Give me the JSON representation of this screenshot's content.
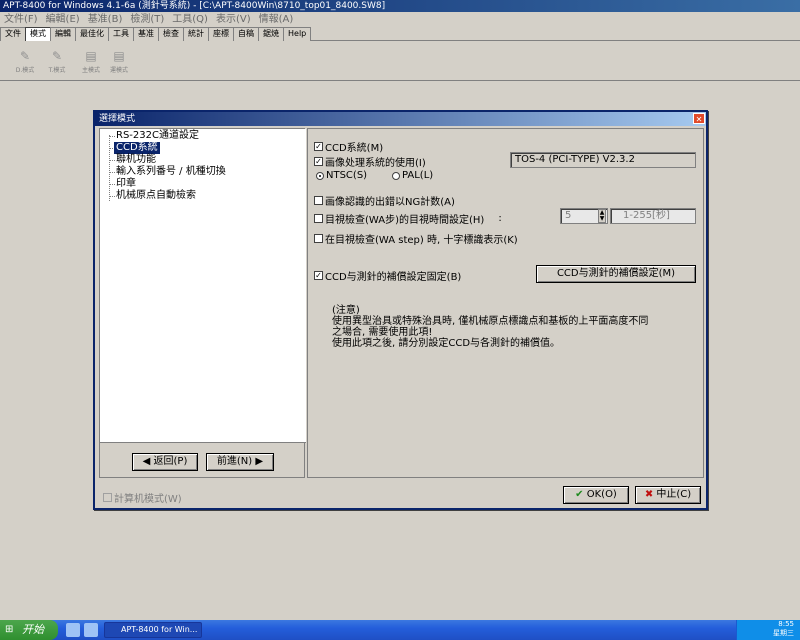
{
  "window": {
    "title": "APT-8400 for Windows 4.1-6a (測針号系統) - [C:\\APT-8400Win\\8710_top01_8400.SW8]"
  },
  "menu": [
    "文件(F)",
    "編輯(E)",
    "基准(B)",
    "檢測(T)",
    "工具(Q)",
    "表示(V)",
    "情報(A)"
  ],
  "tabs": [
    "文件",
    "模式",
    "編輯",
    "最佳化",
    "工具",
    "基准",
    "檢查",
    "統計",
    "座標",
    "自稿",
    "鋸焼",
    "Help"
  ],
  "active_tab": "模式",
  "toolbar": [
    {
      "label": "D.模式",
      "icon": "pen-icon"
    },
    {
      "label": "T.模式",
      "icon": "pen-icon"
    },
    {
      "label": "主模式",
      "icon": "document-icon"
    },
    {
      "label": "運模式",
      "icon": "document-icon"
    }
  ],
  "dialog": {
    "title": "選擇模式",
    "tree": [
      "RS-232C通道設定",
      "CCD系統",
      "聯机功能",
      "輸入系列番号 / 机種切換",
      "印章",
      "机械原点自動檢索"
    ],
    "selected_item": "CCD系統",
    "back_button": "返回(P)",
    "next_button": "前進(N)",
    "calc_mode": "計算机模式(W)",
    "ok_button": "OK(O)",
    "cancel_button": "中止(C)",
    "ccd_system": "CCD系統(M)",
    "image_processing": "画像处理系統的使用(I)",
    "version": "TOS-4 (PCI-TYPE) V2.3.2",
    "ntsc": "NTSC(S)",
    "pal": "PAL(L)",
    "ng_count": "画像認識的出錯以NG計数(A)",
    "visual_time": "目視檢查(WA步)的目視時間設定(H)",
    "colon": ":",
    "time_value": "5",
    "time_range": "1-255[秒]",
    "crosshair": "在目視檢查(WA step) 時, 十字標識表示(K)",
    "ccd_fixed": "CCD与測針的補償設定固定(B)",
    "ccd_button": "CCD与測針的補償設定(M)",
    "note": "(注意)\n使用異型治具或特殊治具時, 僅机械原点標識点和基板的上平面高度不同\n之場合, 需要使用此項!\n使用此項之後, 請分別設定CCD与各測針的補償值。"
  },
  "taskbar": {
    "start": "开始",
    "task": "APT-8400 for Win...",
    "time": "8:55",
    "day": "星期三"
  }
}
